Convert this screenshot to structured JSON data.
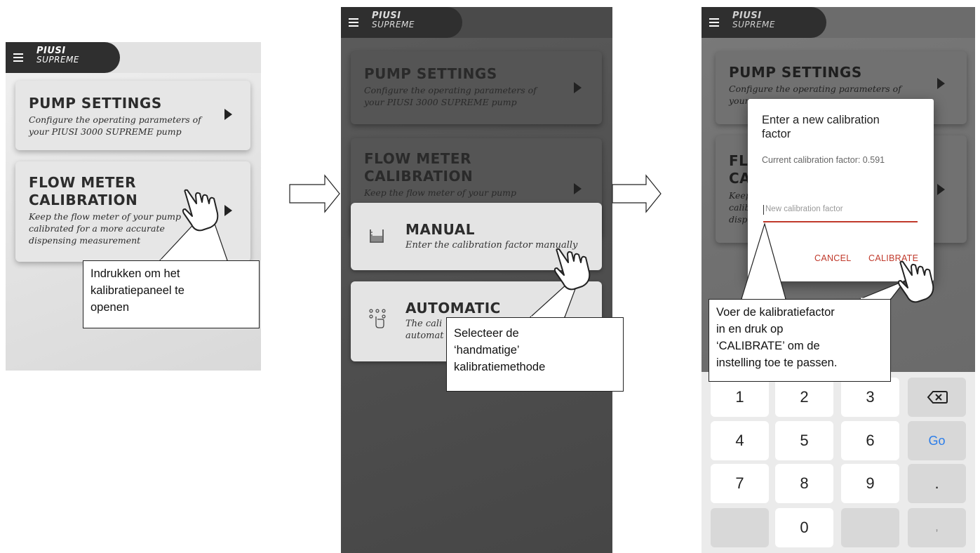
{
  "brand": {
    "line1": "PIUSI",
    "line2": "SUPREME"
  },
  "pump_settings": {
    "title": "PUMP SETTINGS",
    "desc_line1": "Configure the operating parameters of",
    "desc_line2": "your PIUSI 3000 SUPREME pump"
  },
  "flow_meter": {
    "title_line1": "FLOW METER",
    "title_line2": "CALIBRATION",
    "desc_line1": "Keep the flow meter of your pump",
    "desc_line2": "calibrated for a more accurate",
    "desc_line3": "dispensing measurement"
  },
  "screen2": {
    "pump_desc_line2": "your PIUSI 3000 SUPREME pump",
    "manual": {
      "title": "MANUAL",
      "desc": "Enter the calibration factor manually"
    },
    "automatic": {
      "title": "AUTOMATIC",
      "desc_line1": "The cali",
      "desc_line2": "automat"
    }
  },
  "screen3": {
    "pump_desc_line1": "Configure the operating parameters of",
    "pump_desc_line2": "your",
    "flow_title_line1": "FL",
    "flow_title_line2": "CA",
    "flow_desc_line1": "Keep",
    "flow_desc_line2": "calib",
    "flow_desc_line3": "disp",
    "dialog": {
      "title_line1": "Enter a new calibration",
      "title_line2": "factor",
      "current": "Current calibration factor: 0.591",
      "placeholder": "New calibration factor",
      "cancel": "CANCEL",
      "calibrate": "CALIBRATE"
    },
    "keypad": {
      "row1": [
        "1",
        "2",
        "3"
      ],
      "row2": [
        "4",
        "5",
        "6",
        "Go"
      ],
      "row3": [
        "7",
        "8",
        "9",
        "."
      ],
      "row4": [
        "",
        "0",
        "",
        ","
      ],
      "backspace_icon": "backspace-icon"
    }
  },
  "callouts": {
    "c1": [
      "Indrukken om het",
      "kalibratiepaneel te",
      "openen"
    ],
    "c2": [
      "Selecteer de",
      "‘handmatige’",
      "kalibratiemethode"
    ],
    "c3": [
      "Voer de kalibratiefactor",
      "in en druk op",
      "‘CALIBRATE’ om de",
      "instelling toe te passen."
    ]
  },
  "colors": {
    "accent_red": "#c0392b",
    "go_blue": "#2b7de9"
  },
  "icons": [
    "menu-icon",
    "play-arrow-icon",
    "hand-pointer-icon",
    "beaker-icon",
    "touch-dots-icon",
    "arrow-right-icon",
    "backspace-icon"
  ]
}
